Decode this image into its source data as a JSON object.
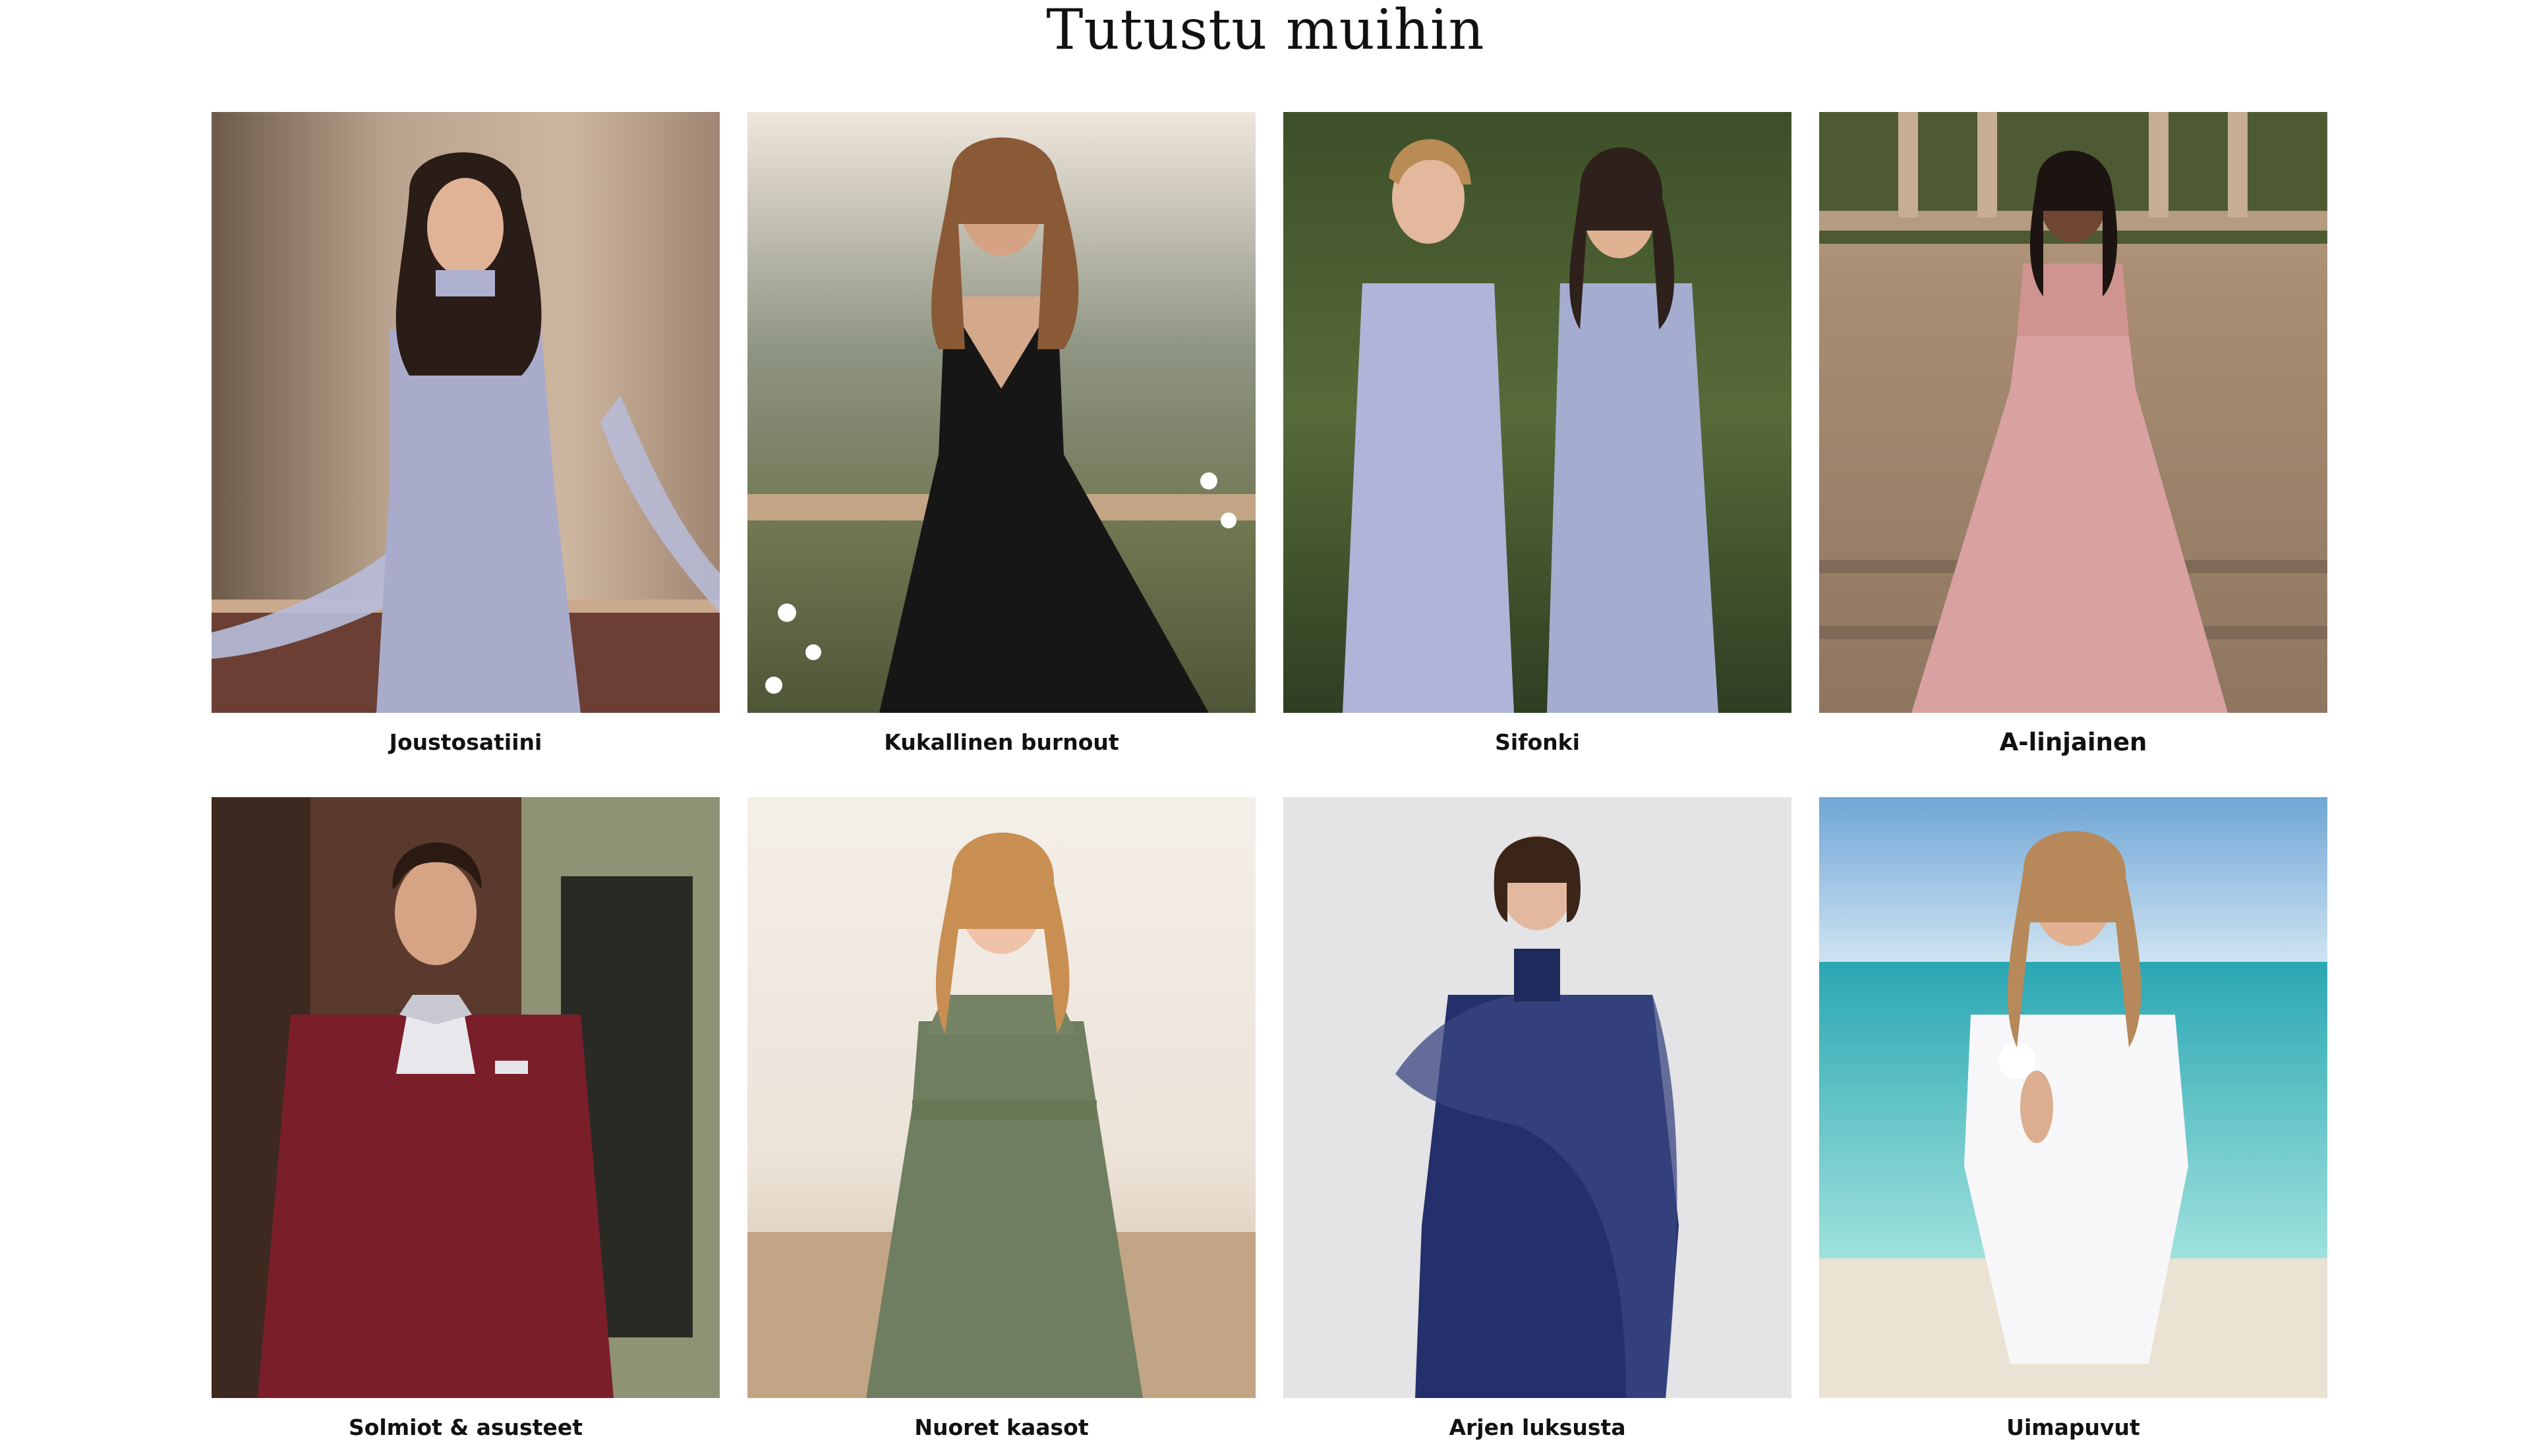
{
  "page": {
    "title": "Tutustu muihin"
  },
  "categories": [
    {
      "label": "Joustosatiini",
      "image": "model in lavender satin gown with sheer scarf"
    },
    {
      "label": "Kukallinen burnout",
      "image": "model in black pleated chiffon gown"
    },
    {
      "label": "Sifonki",
      "image": "two models in light blue chiffon dresses"
    },
    {
      "label": "A-linjainen",
      "image": "model in dusty pink one-shoulder gown"
    },
    {
      "label": "Solmiot & asusteet",
      "image": "man in burgundy three-piece suit with bow tie"
    },
    {
      "label": "Nuoret kaasot",
      "image": "girl in sage green halter dress"
    },
    {
      "label": "Arjen luksusta",
      "image": "model in navy satin slip dress with sheer cape"
    },
    {
      "label": "Uimapuvut",
      "image": "model in white swimsuit on beach"
    }
  ],
  "colors": {
    "background": "#ffffff",
    "text": "#111111"
  }
}
